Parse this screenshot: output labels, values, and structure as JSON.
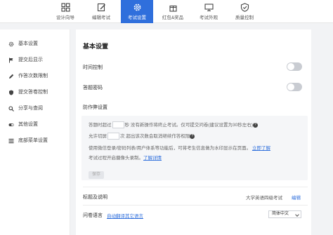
{
  "top_tabs": [
    {
      "label": "设计向导",
      "icon": "grid-icon",
      "active": false
    },
    {
      "label": "编辑考试",
      "icon": "edit-icon",
      "active": false
    },
    {
      "label": "考试设置",
      "icon": "gear-icon",
      "active": true
    },
    {
      "label": "红包&奖品",
      "icon": "gift-icon",
      "active": false
    },
    {
      "label": "考试外观",
      "icon": "monitor-icon",
      "active": false
    },
    {
      "label": "质量控制",
      "icon": "shield-icon",
      "active": false
    }
  ],
  "sidebar": {
    "items": [
      {
        "label": "基本设置",
        "icon": "gear-icon"
      },
      {
        "label": "提交后显示",
        "icon": "flag-icon"
      },
      {
        "label": "作答次数限制",
        "icon": "pencil-icon"
      },
      {
        "label": "提交答卷控制",
        "icon": "shield-icon"
      },
      {
        "label": "分享与查阅",
        "icon": "search-icon"
      },
      {
        "label": "其他设置",
        "icon": "toggle-icon"
      },
      {
        "label": "底部菜单设置",
        "icon": "menu-icon"
      }
    ]
  },
  "main": {
    "title": "基本设置",
    "time_control_label": "时间控制",
    "answer_password_label": "答题密码",
    "anti_cheat_label": "防作弊设置",
    "anti_cheat": {
      "line1_prefix": "答题时超过",
      "line1_unit": "秒",
      "line1_suffix": "没有新操作将终止考试。仅可提交问卷(建议设置为30秒左右)",
      "line2_prefix": "允许切屏",
      "line2_unit": "次",
      "line2_suffix": "超出该次数会取消继续作答权限",
      "line3": "使用微信登录/密码列表/用户体系等功能后，可将考生信息做为水印显示在页面。",
      "line3_link": "立即了解",
      "line4": "考试过程开启摄像头录制。",
      "line4_link": "了解详情",
      "save_label": "保存"
    },
    "title_desc_label": "标题及说明",
    "title_desc_value": "大学英语四级考试",
    "edit_label": "编辑",
    "lang_label": "问卷语言",
    "lang_link": "自动翻译其它语言",
    "lang_select": "简体中文"
  }
}
